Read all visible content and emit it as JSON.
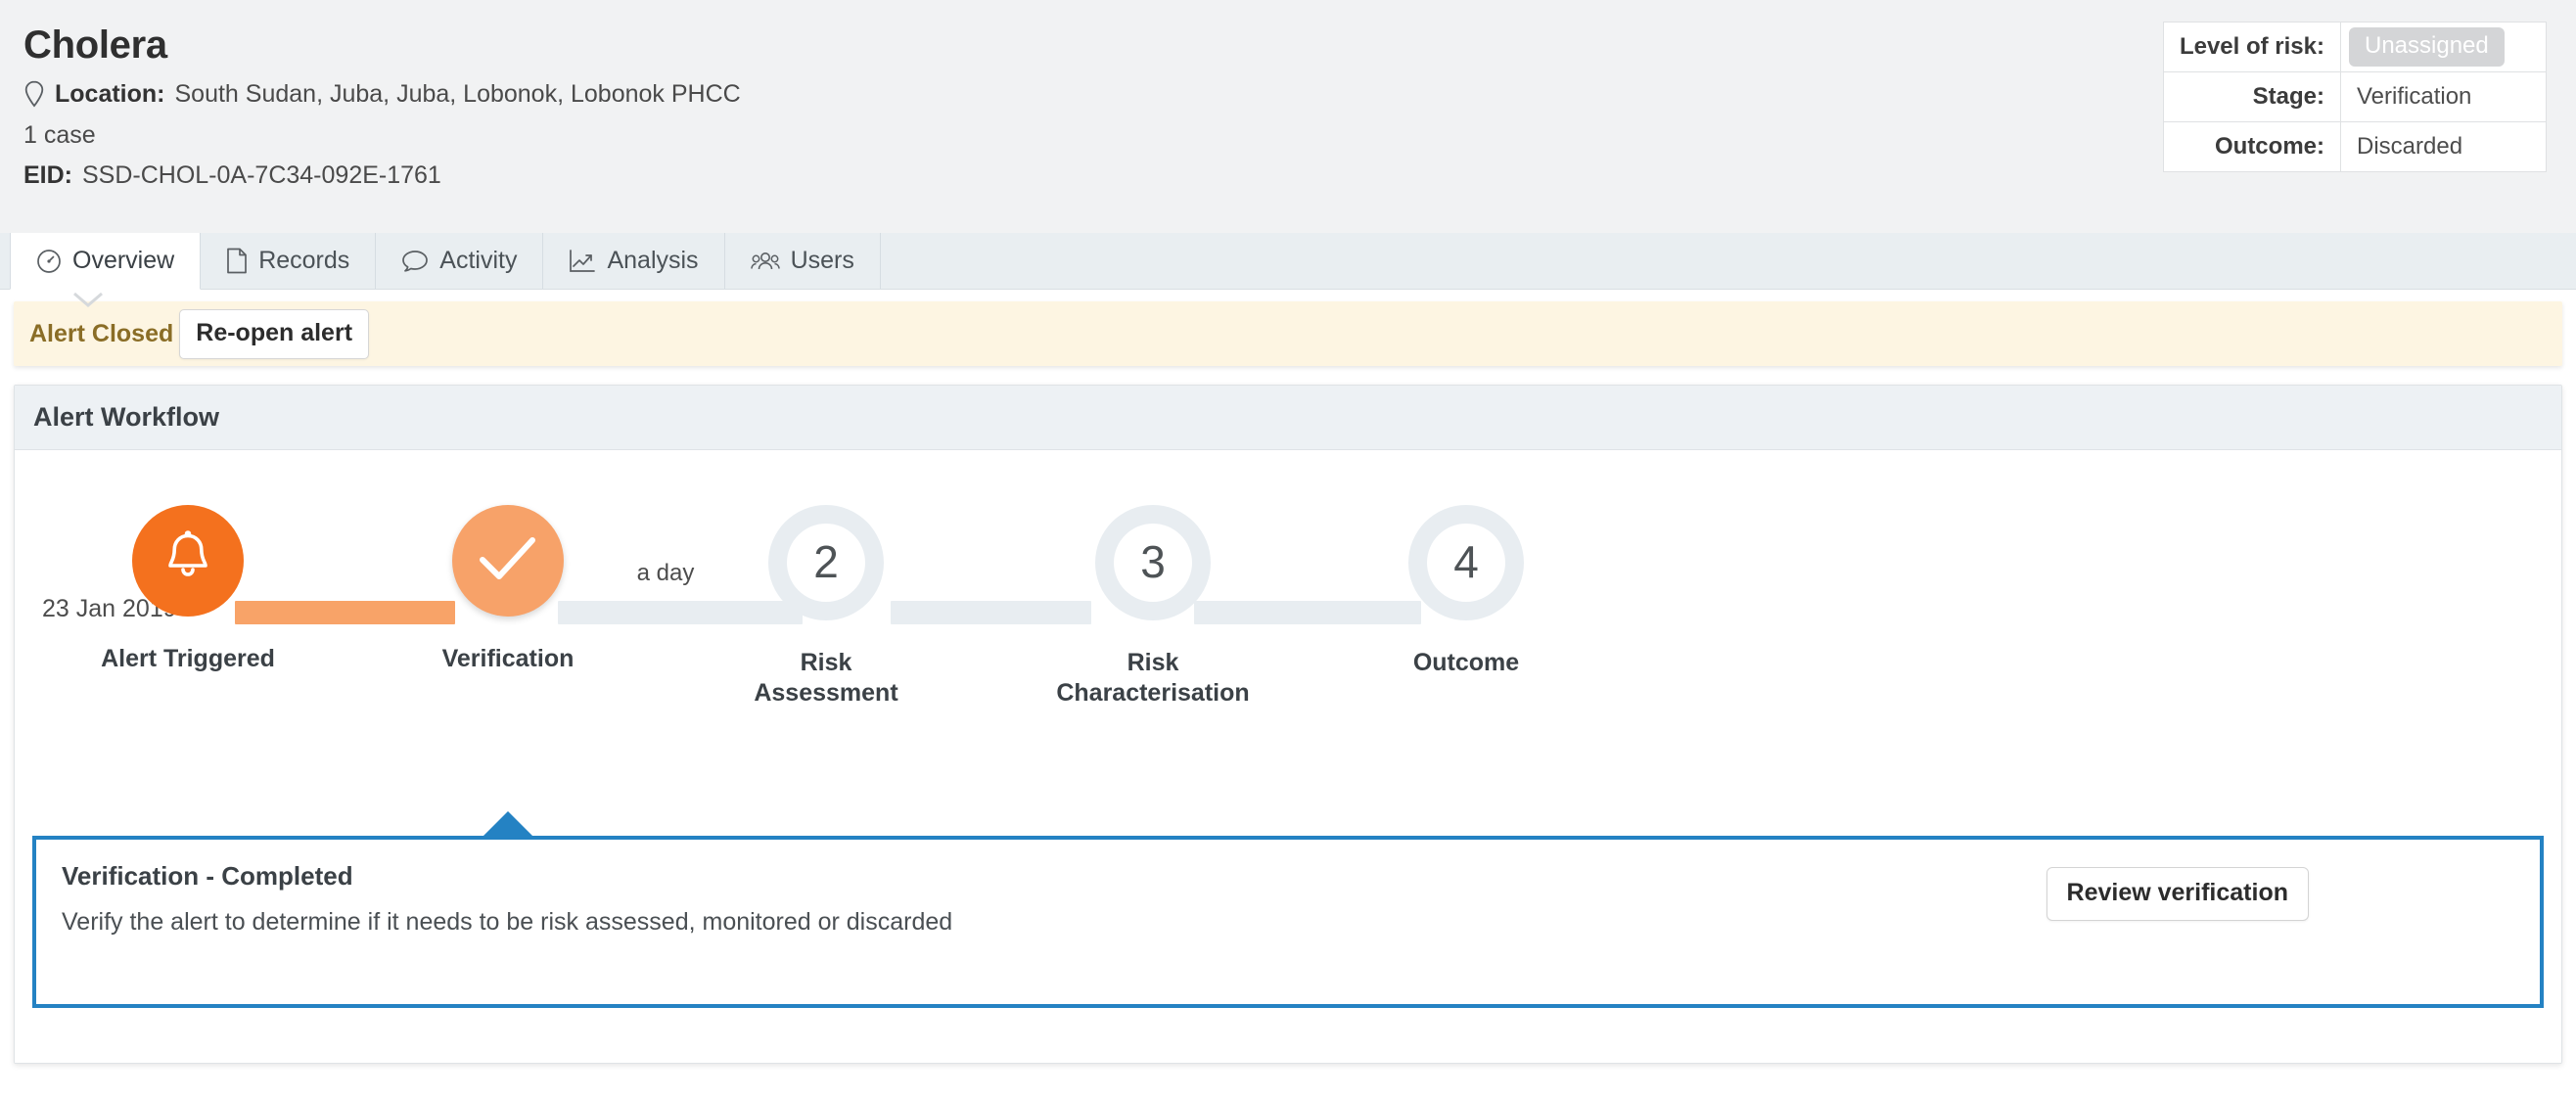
{
  "header": {
    "title": "Cholera",
    "location_icon": "map-pin-icon",
    "location_label": "Location:",
    "location_value": "South Sudan, Juba, Juba, Lobonok, Lobonok PHCC",
    "case_count": "1 case",
    "eid_label": "EID:",
    "eid_value": "SSD-CHOL-0A-7C34-092E-1761",
    "risk_table": {
      "rows": [
        {
          "key": "Level of risk:",
          "value": "Unassigned",
          "badge": true
        },
        {
          "key": "Stage:",
          "value": "Verification",
          "badge": false
        },
        {
          "key": "Outcome:",
          "value": "Discarded",
          "badge": false
        }
      ]
    }
  },
  "tabs": [
    {
      "label": "Overview",
      "icon": "gauge-icon",
      "active": true
    },
    {
      "label": "Records",
      "icon": "document-icon",
      "active": false
    },
    {
      "label": "Activity",
      "icon": "speech-bubble-icon",
      "active": false
    },
    {
      "label": "Analysis",
      "icon": "line-chart-icon",
      "active": false
    },
    {
      "label": "Users",
      "icon": "users-group-icon",
      "active": false
    }
  ],
  "banner": {
    "status_text": "Alert Closed",
    "button_label": "Re-open alert",
    "background_color": "#fdf5e2",
    "text_color": "#8a6d26"
  },
  "workflow": {
    "card_title": "Alert Workflow",
    "date_label": "23 Jan 2019",
    "duration_label": "a day",
    "colors": {
      "completed": "#f4711e",
      "current": "#f7a269",
      "pending_ring": "#e8edf1",
      "accent_blue": "#2482c3"
    },
    "steps": [
      {
        "label": "Alert Triggered",
        "icon": "bell-icon",
        "state": "completed",
        "number": ""
      },
      {
        "label": "Verification",
        "icon": "check-icon",
        "state": "current",
        "number": ""
      },
      {
        "label": "Risk Assessment",
        "icon": "",
        "state": "pending",
        "number": "2"
      },
      {
        "label": "Risk Characterisation",
        "icon": "",
        "state": "pending",
        "number": "3"
      },
      {
        "label": "Outcome",
        "icon": "",
        "state": "pending",
        "number": "4"
      }
    ],
    "detail": {
      "title": "Verification - Completed",
      "description": "Verify the alert to determine if it needs to be risk assessed, monitored or discarded",
      "button_label": "Review verification"
    }
  }
}
